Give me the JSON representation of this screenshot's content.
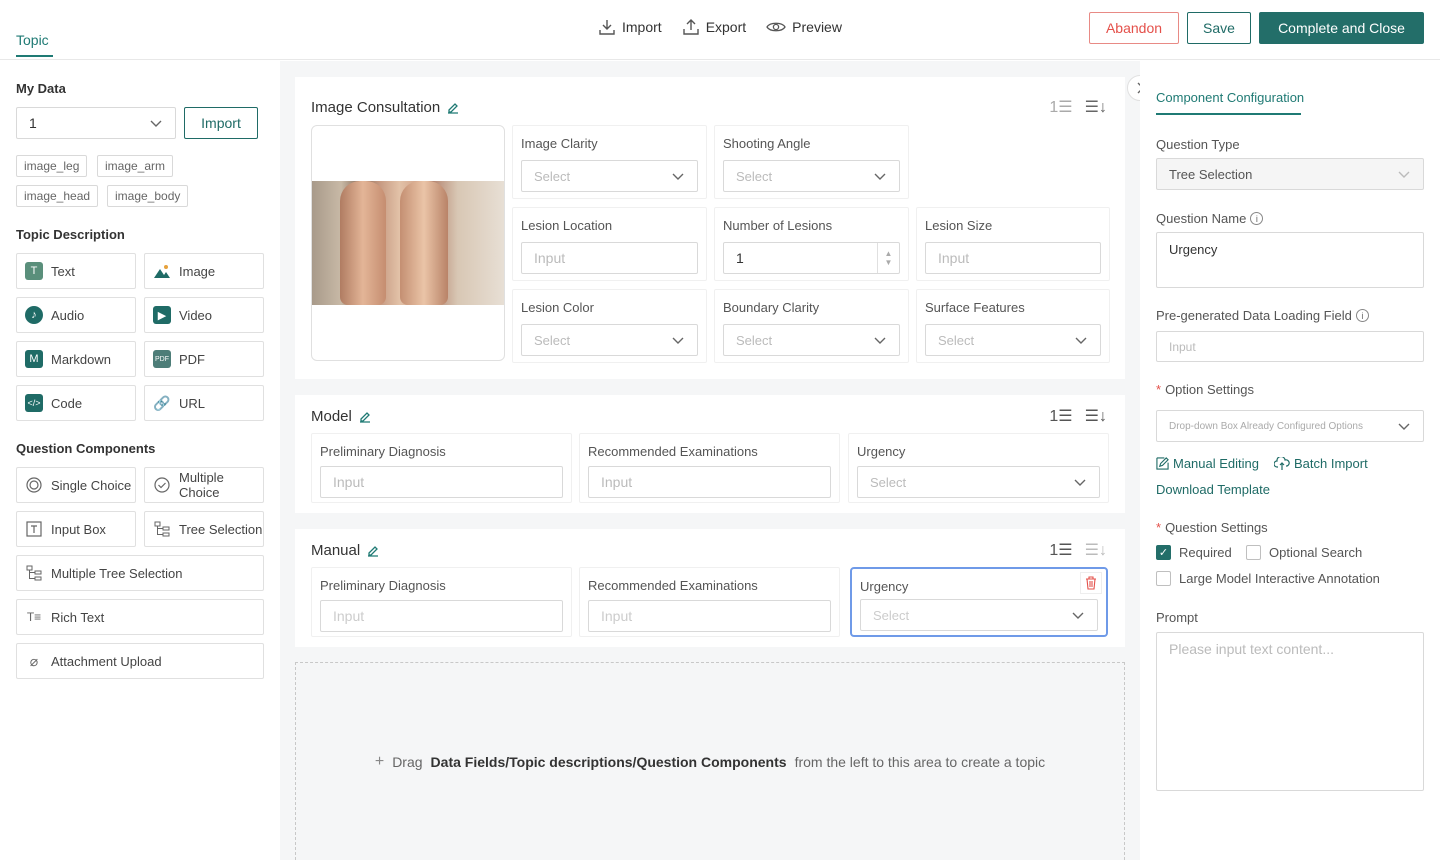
{
  "header": {
    "topic_tab": "Topic",
    "actions": {
      "import": "Import",
      "export": "Export",
      "preview": "Preview"
    },
    "abandon": "Abandon",
    "save": "Save",
    "complete": "Complete and Close"
  },
  "left": {
    "my_data_title": "My Data",
    "my_data_select": "1",
    "import_button": "Import",
    "tags": [
      "image_leg",
      "image_arm",
      "image_head",
      "image_body"
    ],
    "topic_desc_title": "Topic Description",
    "topic_desc": [
      "Text",
      "Image",
      "Audio",
      "Video",
      "Markdown",
      "PDF",
      "Code",
      "URL"
    ],
    "question_title": "Question Components",
    "questions": [
      "Single Choice",
      "Multiple Choice",
      "Input Box",
      "Tree Selection",
      "Multiple Tree Selection",
      "Rich Text",
      "Attachment Upload"
    ]
  },
  "canvas": {
    "card1": {
      "title": "Image Consultation",
      "fields": [
        {
          "label": "Image Clarity",
          "value": "Select"
        },
        {
          "label": "Shooting Angle",
          "value": "Select"
        },
        {
          "label": "Lesion Location",
          "value": "Input"
        },
        {
          "label": "Number of Lesions",
          "value": "1"
        },
        {
          "label": "Lesion Size",
          "value": "Input"
        },
        {
          "label": "Lesion Color",
          "value": "Select"
        },
        {
          "label": "Boundary Clarity",
          "value": "Select"
        },
        {
          "label": "Surface Features",
          "value": "Select"
        }
      ]
    },
    "card2": {
      "title": "Model",
      "fields": [
        {
          "label": "Preliminary Diagnosis",
          "value": "Input"
        },
        {
          "label": "Recommended Examinations",
          "value": "Input"
        },
        {
          "label": "Urgency",
          "value": "Select"
        }
      ]
    },
    "card3": {
      "title": "Manual",
      "fields": [
        {
          "label": "Preliminary Diagnosis",
          "value": "Input"
        },
        {
          "label": "Recommended Examinations",
          "value": "Input"
        },
        {
          "label": "Urgency",
          "value": "Select"
        }
      ]
    },
    "dropzone": {
      "prefix": "Drag",
      "bold": "Data Fields/Topic descriptions/Question Components",
      "suffix": "from the left to this area to create a topic"
    }
  },
  "right": {
    "tab": "Component Configuration",
    "question_type_label": "Question Type",
    "question_type_value": "Tree Selection",
    "question_name_label": "Question Name",
    "question_name_value": "Urgency",
    "pregen_label": "Pre-generated Data Loading Field",
    "pregen_placeholder": "Input",
    "option_settings_label": "Option Settings",
    "option_select": "Drop-down Box Already Configured Options",
    "manual_editing": "Manual Editing",
    "batch_import": "Batch Import",
    "download_template": "Download Template",
    "question_settings_label": "Question Settings",
    "required": "Required",
    "optional_search": "Optional Search",
    "llm_annotation": "Large Model Interactive Annotation",
    "prompt_label": "Prompt",
    "prompt_placeholder": "Please input text content..."
  },
  "colors": {
    "accent": "#236e69",
    "danger": "#e4504a",
    "focus": "#5b8def"
  }
}
